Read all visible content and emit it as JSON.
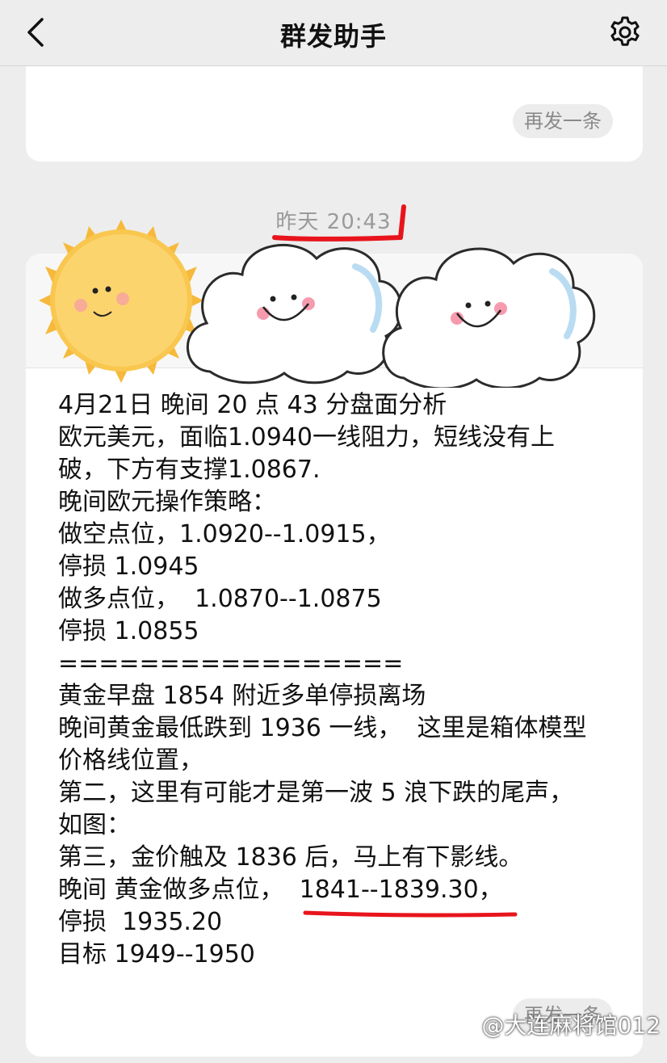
{
  "navbar": {
    "title": "群发助手",
    "back_icon": "chevron-left-icon",
    "settings_icon": "gear-icon"
  },
  "top_card": {
    "resend_label": "再发一条"
  },
  "timestamp": "昨天 20:43",
  "main_card": {
    "header_chevron_icon": "chevron-right-icon",
    "message_lines": [
      "4月21日 晚间 20 点 43 分盘面分析",
      "欧元美元，面临1.0940一线阻力，短线没有上",
      "破，下方有支撑1.0867.",
      "晚间欧元操作策略：",
      "做空点位，1.0920--1.0915，",
      "停损 1.0945",
      "做多点位，  1.0870--1.0875",
      "停损 1.0855",
      "=================",
      "黄金早盘 1854 附近多单停损离场",
      "晚间黄金最低跌到 1936 一线，  这里是箱体模型",
      "价格线位置，",
      "第二，这里有可能才是第一波 5 浪下跌的尾声，",
      "如图：",
      "第三，金价触及 1836 后，马上有下影线。",
      "晚间 黄金做多点位，  1841--1839.30，",
      "停损  1935.20",
      "目标 1949--1950"
    ],
    "resend_label": "再发一条"
  },
  "watermark": "@大连麻将馆012",
  "colors": {
    "background": "#ededed",
    "card": "#ffffff",
    "annotation_red": "#e8141c",
    "sun": "#f9c74f"
  }
}
